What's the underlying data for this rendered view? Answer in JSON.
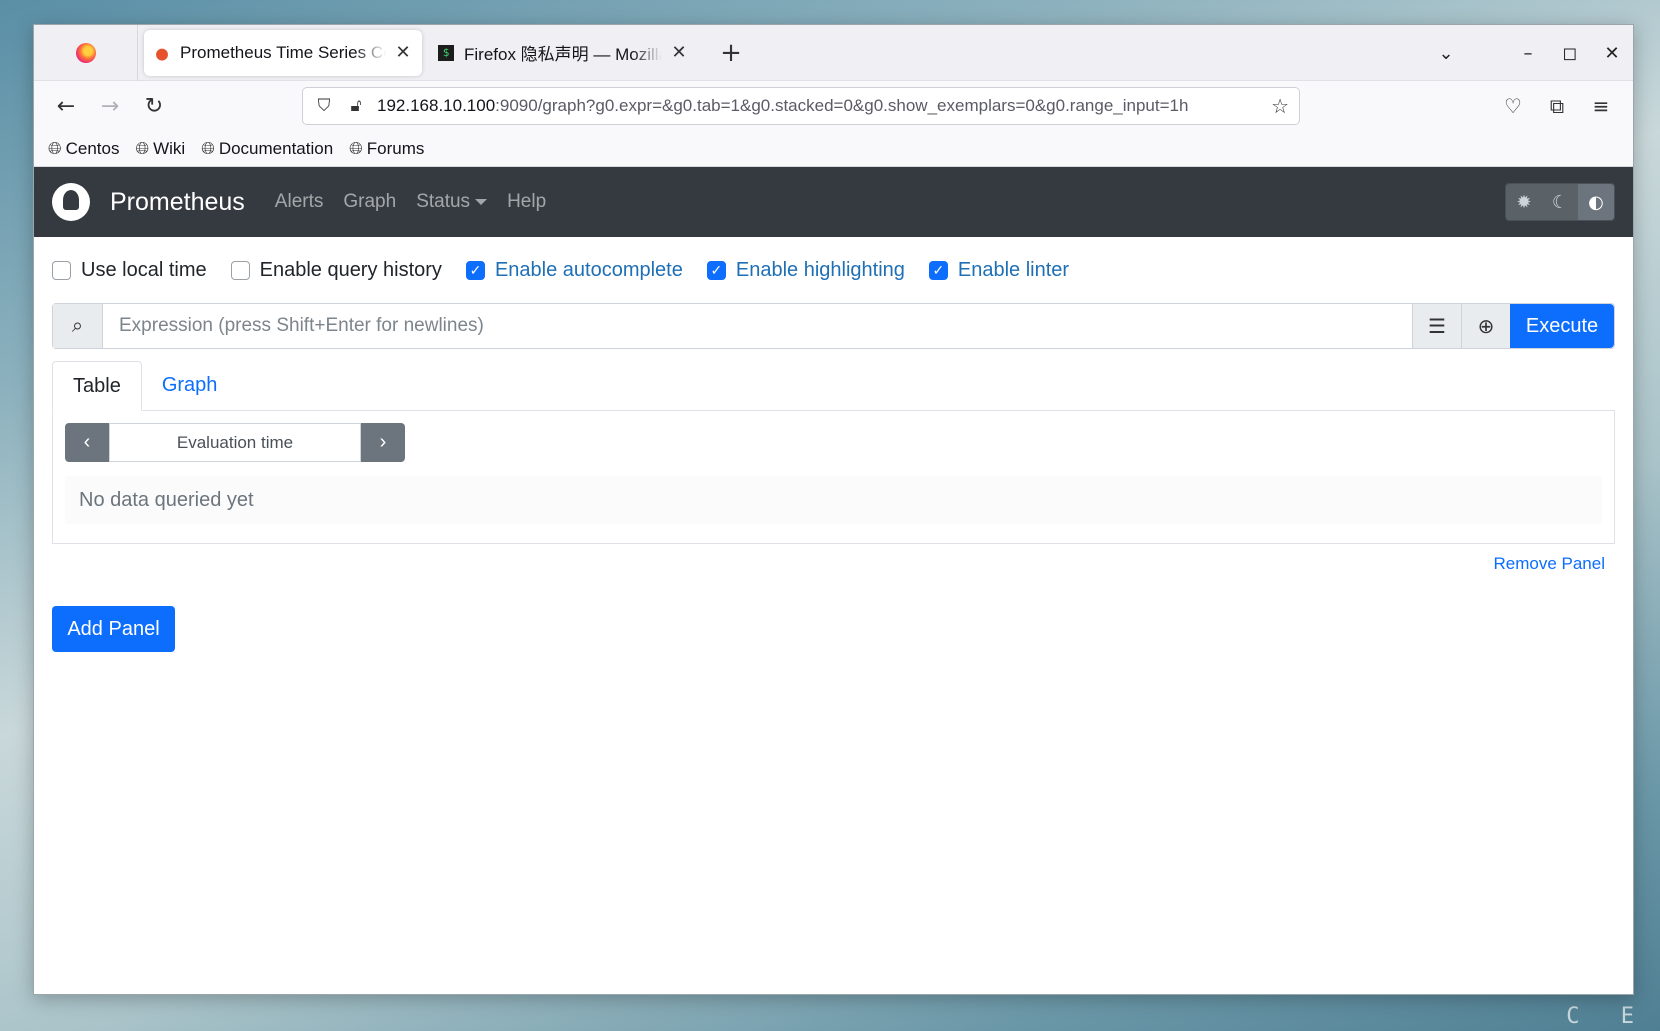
{
  "browser": {
    "tabs": [
      {
        "title": "Prometheus Time Series Collection and Processing Server",
        "active": true
      },
      {
        "title": "Firefox 隐私声明 — Mozilla",
        "active": false
      }
    ],
    "new_tab": "+",
    "url_host": "192.168.10.100",
    "url_path": ":9090/graph?g0.expr=&g0.tab=1&g0.stacked=0&g0.show_exemplars=0&g0.range_input=1h",
    "bookmarks": [
      "Centos",
      "Wiki",
      "Documentation",
      "Forums"
    ]
  },
  "prometheus": {
    "brand": "Prometheus",
    "nav": {
      "alerts": "Alerts",
      "graph": "Graph",
      "status": "Status",
      "help": "Help"
    },
    "options": {
      "local_time": "Use local time",
      "query_history": "Enable query history",
      "autocomplete": "Enable autocomplete",
      "highlighting": "Enable highlighting",
      "linter": "Enable linter"
    },
    "expression": {
      "placeholder": "Expression (press Shift+Enter for newlines)",
      "value": ""
    },
    "execute_label": "Execute",
    "panel": {
      "tab_table": "Table",
      "tab_graph": "Graph",
      "eval_placeholder": "Evaluation time",
      "no_data": "No data queried yet",
      "remove_label": "Remove Panel"
    },
    "add_panel_label": "Add Panel"
  },
  "desktop_hint": "C E",
  "colors": {
    "primary": "#0d6efd",
    "navbar": "#343a40",
    "checked_label": "#1f6fb5"
  }
}
